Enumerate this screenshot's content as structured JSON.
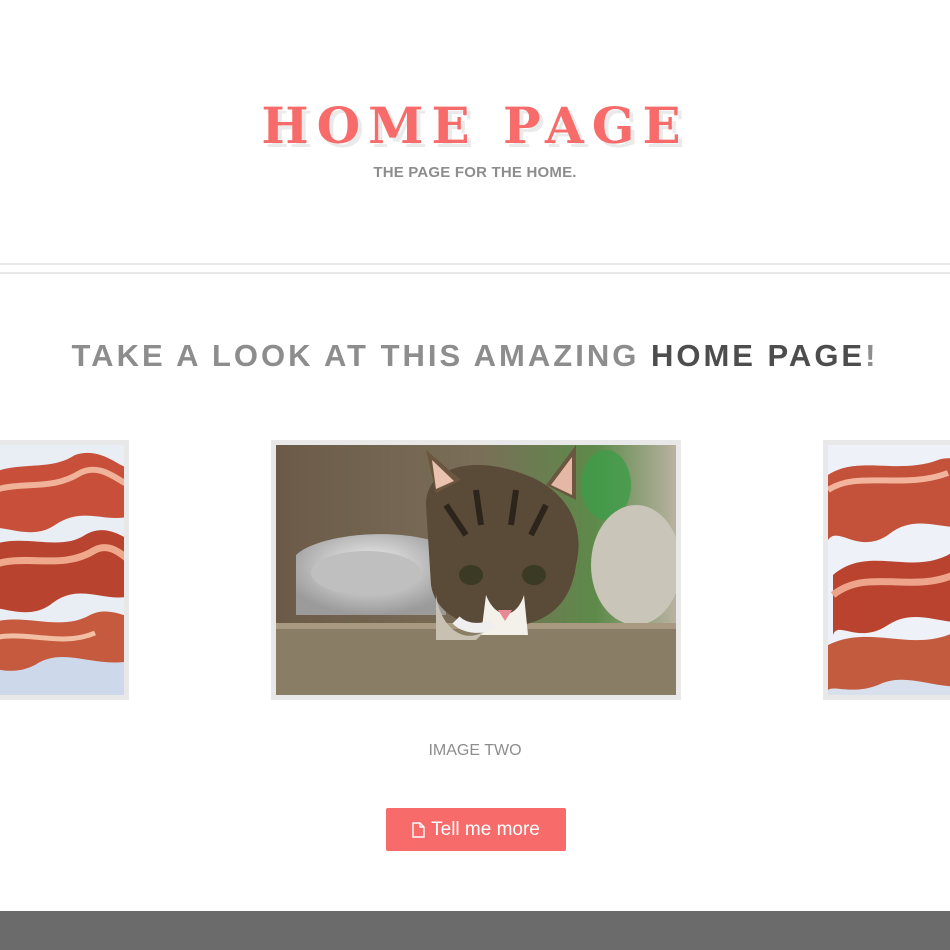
{
  "header": {
    "title": "HOME PAGE",
    "tagline": "THE PAGE FOR THE HOME."
  },
  "section": {
    "heading_light": "TAKE A LOOK AT THIS AMAZING ",
    "heading_strong": "HOME PAGE",
    "heading_end": "!"
  },
  "carousel": {
    "slides": [
      {
        "subject": "bacon"
      },
      {
        "subject": "kitten"
      },
      {
        "subject": "bacon"
      }
    ],
    "active_index": 1,
    "caption": "IMAGE TWO"
  },
  "cta": {
    "label": "Tell me more",
    "icon": "document-icon"
  },
  "colors": {
    "accent": "#f76b6a",
    "muted_text": "#8d8d8d",
    "dark_text": "#4d4d4d",
    "footer": "#6b6b6b"
  }
}
